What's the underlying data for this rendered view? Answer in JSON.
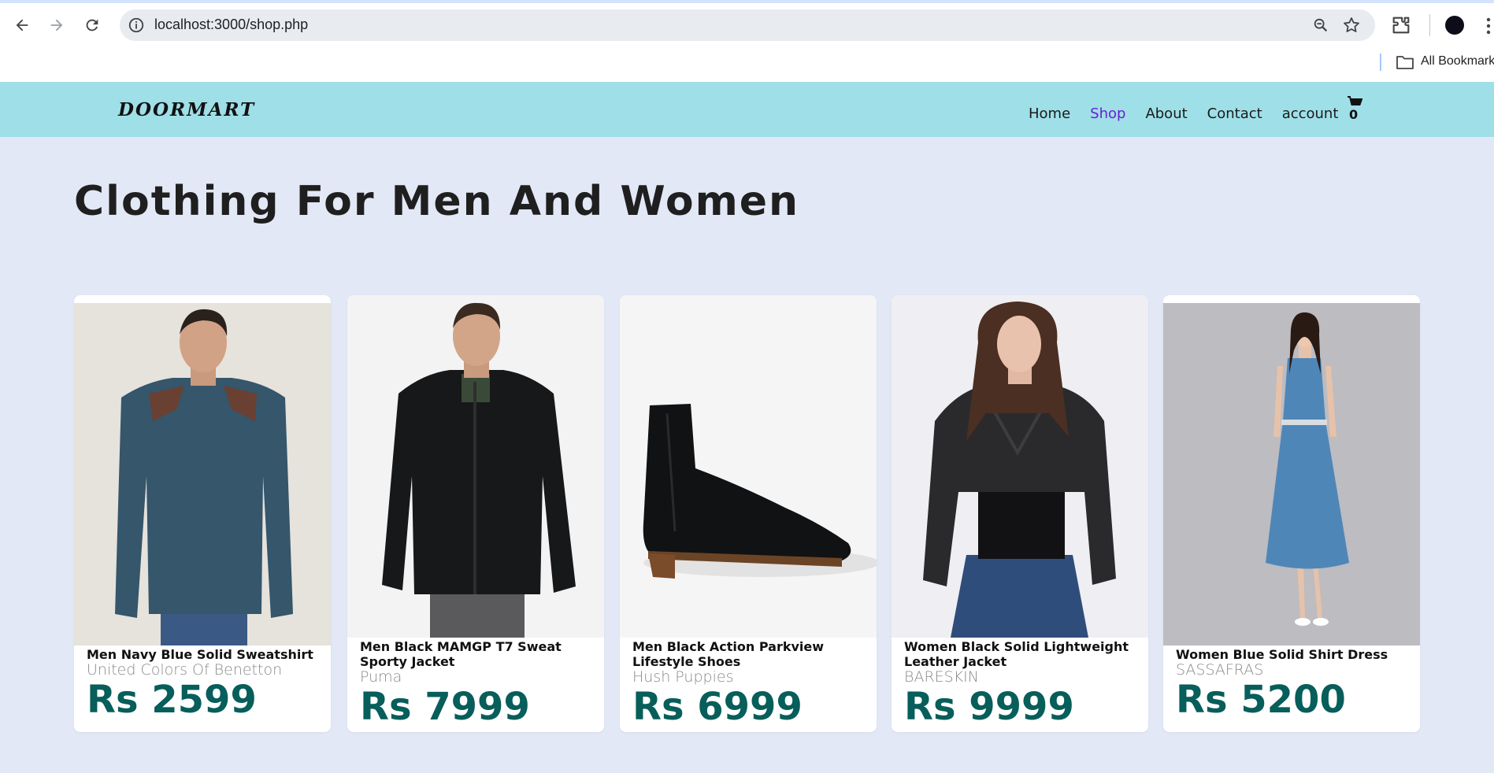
{
  "browser": {
    "url": "localhost:3000/shop.php",
    "bookmarks_label": "All Bookmarks"
  },
  "site": {
    "logo": "DOORMART",
    "nav": [
      {
        "label": "Home",
        "active": false
      },
      {
        "label": "Shop",
        "active": true
      },
      {
        "label": "About",
        "active": false
      },
      {
        "label": "Contact",
        "active": false
      },
      {
        "label": "account",
        "active": false
      }
    ],
    "cart_count": "0"
  },
  "page": {
    "title": "Clothing For Men And Women"
  },
  "products": [
    {
      "name": "Men Navy Blue Solid Sweatshirt",
      "brand": "United Colors Of Benetton",
      "price": "Rs 2599",
      "image": "navy-sweatshirt-model"
    },
    {
      "name": "Men Black MAMGP T7 Sweat Sporty Jacket",
      "brand": "Puma",
      "price": "Rs 7999",
      "image": "black-sporty-jacket-model"
    },
    {
      "name": "Men Black Action Parkview Lifestyle Shoes",
      "brand": "Hush Puppies",
      "price": "Rs 6999",
      "image": "black-leather-boot"
    },
    {
      "name": "Women Black Solid Lightweight Leather Jacket",
      "brand": "BARESKIN",
      "price": "Rs 9999",
      "image": "black-leather-jacket-model"
    },
    {
      "name": "Women Blue Solid Shirt Dress",
      "brand": "SASSAFRAS",
      "price": "Rs 5200",
      "image": "blue-shirt-dress-model"
    }
  ],
  "colors": {
    "header_bg": "#9fdfe8",
    "page_bg": "#e3e8f6",
    "price": "#075e5a",
    "nav_active": "#6a1fd6"
  }
}
